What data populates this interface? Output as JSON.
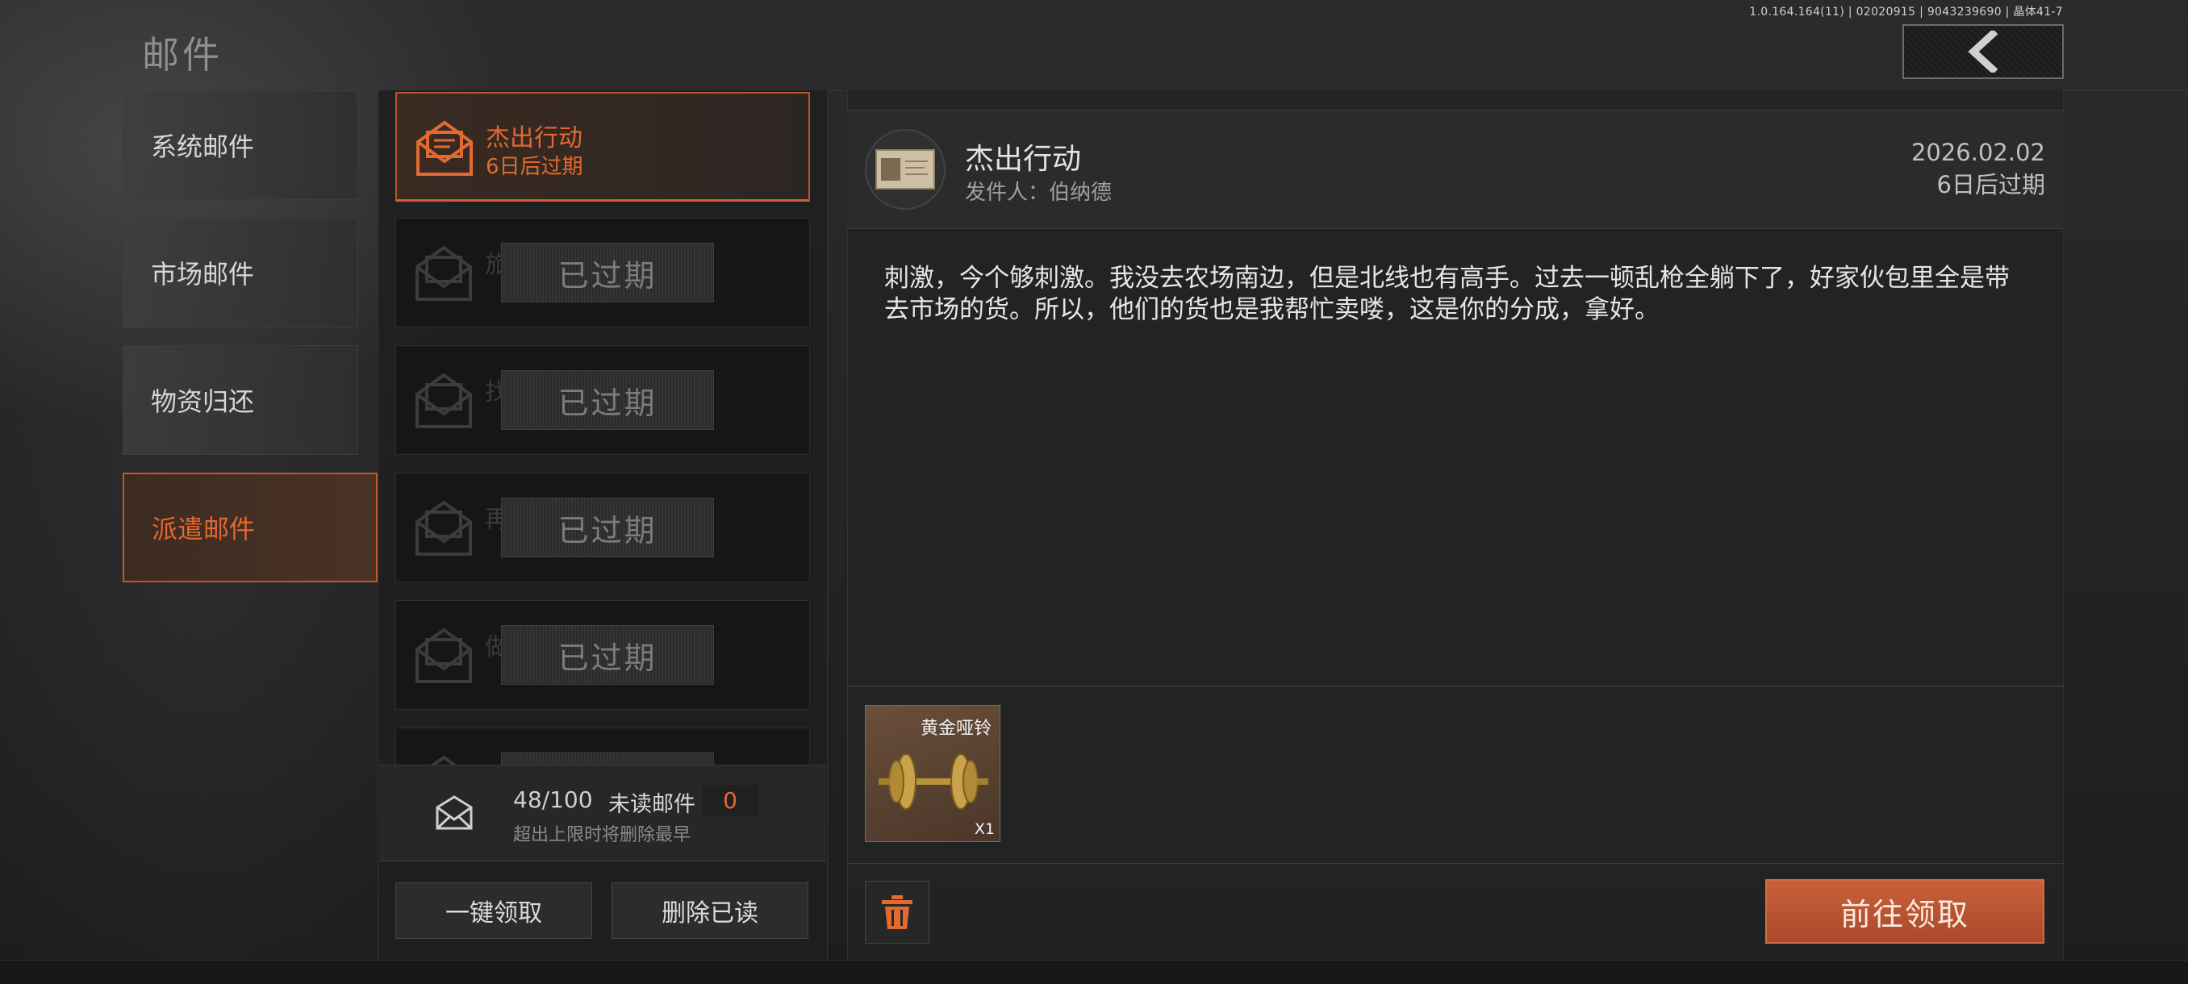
{
  "version": "1.0.164.164(11) | 02020915 | 9043239690 | 晶体41-7",
  "page_title": "邮件",
  "categories": [
    {
      "label": "系统邮件",
      "active": false
    },
    {
      "label": "市场邮件",
      "active": false
    },
    {
      "label": "物资归还",
      "active": false
    },
    {
      "label": "派遣邮件",
      "active": true
    }
  ],
  "mail_list": {
    "active": {
      "title": "杰出行动",
      "subtitle": "6日后过期"
    },
    "expired_label": "已过期",
    "expired_ghosts": [
      "旅",
      "找",
      "再",
      "做"
    ]
  },
  "mail_count": {
    "count": "48/100",
    "unread_label": "未读邮件",
    "unread_count": "0",
    "note": "超出上限时将删除最早"
  },
  "buttons": {
    "claim_all": "一键领取",
    "delete_read": "删除已读",
    "go_claim": "前往领取"
  },
  "detail": {
    "title": "杰出行动",
    "sender": "发件人：伯纳德",
    "date": "2026.02.02",
    "expire": "6日后过期",
    "body": "刺激，今个够刺激。我没去农场南边，但是北线也有高手。过去一顿乱枪全躺下了，好家伙包里全是带去市场的货。所以，他们的货也是我帮忙卖喽，这是你的分成，拿好。"
  },
  "attachment": {
    "name": "黄金哑铃",
    "qty": "X1"
  },
  "colors": {
    "accent": "#e2692f",
    "button": "#b9542c"
  }
}
